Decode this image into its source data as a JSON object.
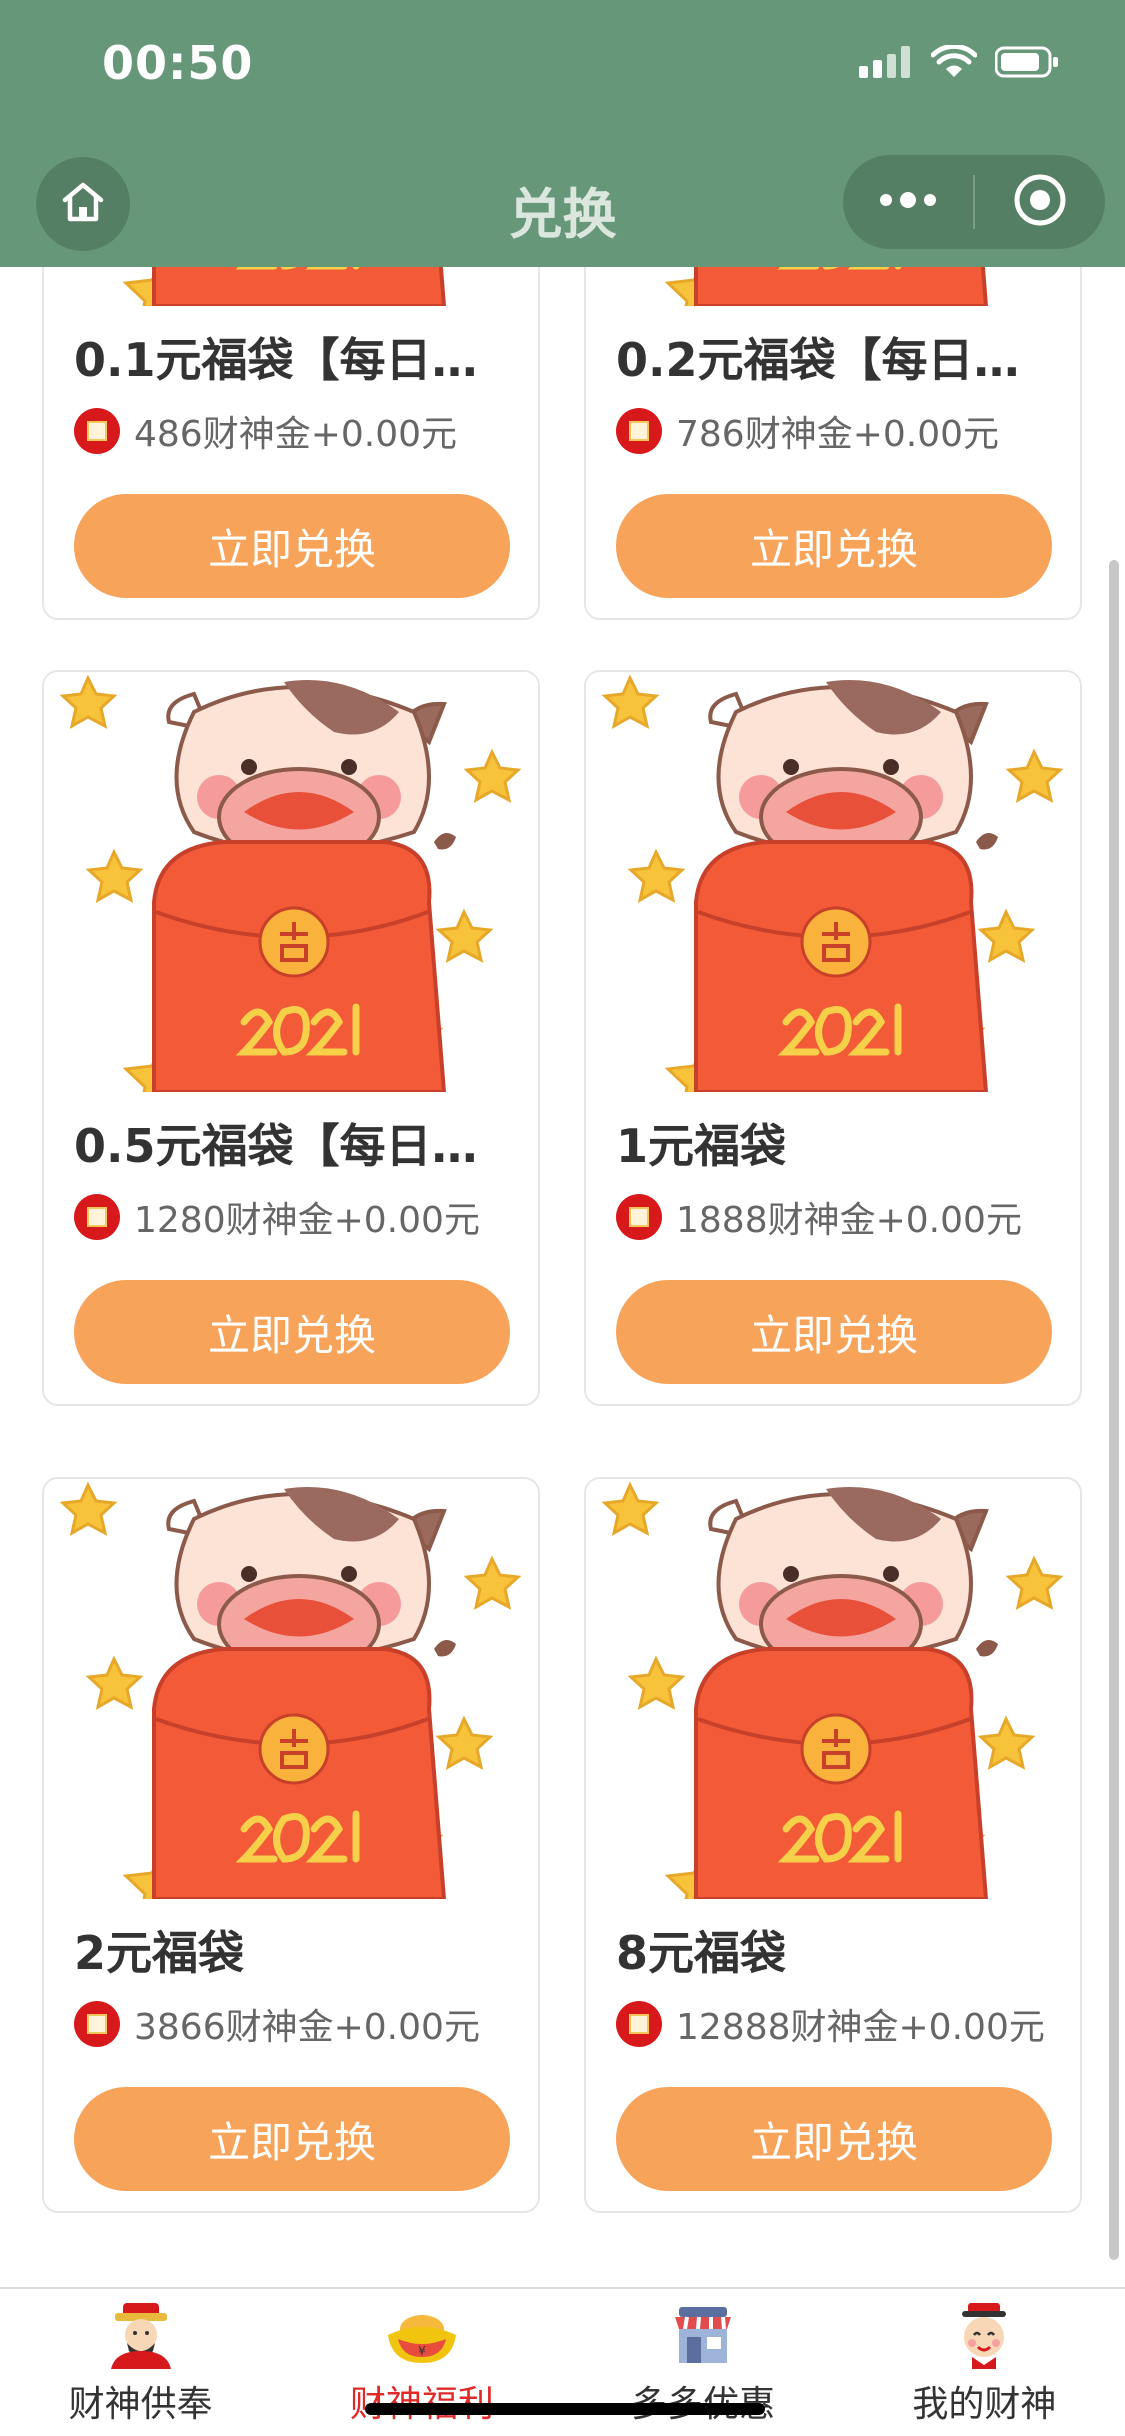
{
  "status_bar": {
    "time": "00:50"
  },
  "header": {
    "title": "兑换"
  },
  "products": [
    {
      "title": "0.1元福袋【每日…",
      "price": "486财神金+0.00元",
      "button": "立即兑换"
    },
    {
      "title": "0.2元福袋【每日…",
      "price": "786财神金+0.00元",
      "button": "立即兑换"
    },
    {
      "title": "0.5元福袋【每日…",
      "price": "1280财神金+0.00元",
      "button": "立即兑换"
    },
    {
      "title": "1元福袋",
      "price": "1888财神金+0.00元",
      "button": "立即兑换"
    },
    {
      "title": "2元福袋",
      "price": "3866财神金+0.00元",
      "button": "立即兑换"
    },
    {
      "title": "8元福袋",
      "price": "12888财神金+0.00元",
      "button": "立即兑换"
    }
  ],
  "tabbar": {
    "items": [
      {
        "label": "财神供奉",
        "icon": "caishen-icon"
      },
      {
        "label": "财神福利",
        "icon": "gold-ingot-icon",
        "active": true
      },
      {
        "label": "多多优惠",
        "icon": "shop-icon"
      },
      {
        "label": "我的财神",
        "icon": "profile-caishen-icon"
      }
    ]
  },
  "colors": {
    "header": "#679779",
    "accent_button": "#f7a35a",
    "active_tab": "#e02a2a"
  }
}
